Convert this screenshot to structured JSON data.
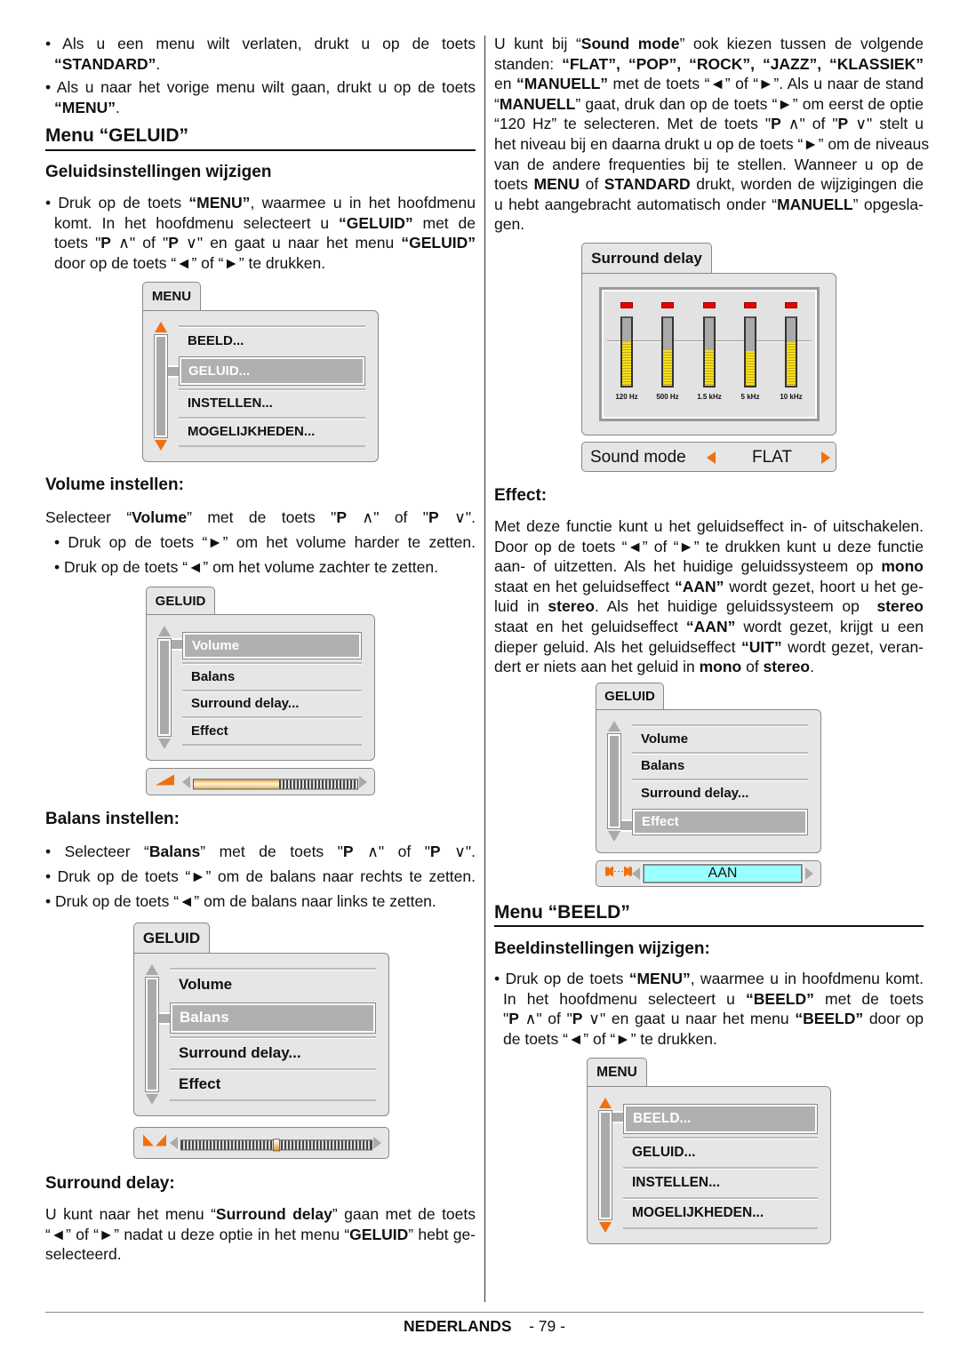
{
  "left": {
    "bullet_exit": [
      [
        "• Als u een menu wilt verlaten, drukt u op de toets"
      ],
      [
        {
          "b": "“STANDARD”"
        },
        "."
      ]
    ],
    "bullet_back": [
      [
        "• Als u naar het vorige menu wilt gaan, drukt u op de toets"
      ],
      [
        {
          "b": "“MENU”"
        },
        "."
      ]
    ],
    "menu_geluid_heading": "Menu “GELUID”",
    "geluid_sub": "Geluidsinstellingen wijzigen",
    "geluid_para": [
      [
        "• Druk op de toets ",
        {
          "b": "“MENU”"
        },
        ", waarmee u in het hoofdmenu"
      ],
      [
        "komt. In het hoofdmenu selecteert u ",
        {
          "b": "“GELUID”"
        },
        " met de"
      ],
      [
        "toets \"",
        {
          "b": "P"
        },
        " ∧\" of \"",
        {
          "b": "P"
        },
        " ∨\" en gaat u naar het menu ",
        {
          "b": "“GELUID”"
        }
      ],
      [
        "door op de toets “◄” of “►” te drukken."
      ]
    ],
    "volume_heading": "Volume instellen:",
    "volume_para": [
      [
        "Selecteer “",
        {
          "b": "Volume"
        },
        "” met de toets \"",
        {
          "b": "P"
        },
        " ∧\" of \"",
        {
          "b": "P"
        },
        " ∨\"."
      ],
      [
        "• Druk op de toets “►” om het volume harder te zetten."
      ],
      [
        "• Druk op de toets “◄” om het volume zachter te zetten."
      ]
    ],
    "balans_heading": "Balans instellen:",
    "balans_para": [
      [
        "• Selecteer “",
        {
          "b": "Balans"
        },
        "” met de toets \"",
        {
          "b": "P"
        },
        " ∧\" of \"",
        {
          "b": "P"
        },
        " ∨\"."
      ],
      [
        "• Druk op de toets “►” om de balans naar rechts te zetten."
      ],
      [
        "• Druk op de toets “◄” om de balans naar links te zetten."
      ]
    ],
    "surround_heading": "Surround delay:",
    "surround_para": [
      [
        "U kunt naar het menu “",
        {
          "b": "Surround delay"
        },
        "” gaan met de toets"
      ],
      [
        "“◄” of “►” nadat u deze optie in het menu “",
        {
          "b": "GELUID"
        },
        "” hebt ge-"
      ],
      [
        "selecteerd."
      ]
    ]
  },
  "right": {
    "soundmode_para": [
      [
        "U kunt bij “",
        {
          "b": "Sound mode"
        },
        "” ook kiezen tussen de volgende"
      ],
      [
        "standen: ",
        {
          "b": "“FLAT”, “POP”, “ROCK”, “JAZZ”, “KLASSIEK”"
        }
      ],
      [
        "en ",
        {
          "b": "“MANUELL”"
        },
        " met de toets “◄” of “►”. Als u naar de stand"
      ],
      [
        "“",
        {
          "b": "MANUELL"
        },
        "” gaat, druk dan op de toets “►” om eerst de optie"
      ],
      [
        "“120 Hz” te selecteren. Met de toets \"",
        {
          "b": "P"
        },
        " ∧\" of \"",
        {
          "b": "P"
        },
        " ∨\" stelt u"
      ],
      [
        "het niveau bij en daarna drukt u op de toets “►” om de niveaus"
      ],
      [
        "van de andere frequenties bij te stellen. Wanneer u op de"
      ],
      [
        "toets ",
        {
          "b": "MENU"
        },
        " of ",
        {
          "b": "STANDARD"
        },
        " drukt, worden de wijzigingen die"
      ],
      [
        "u hebt aangebracht automatisch onder “",
        {
          "b": "MANUELL"
        },
        "” opgesla-"
      ],
      [
        "gen."
      ]
    ],
    "effect_heading": "Effect:",
    "effect_para": [
      [
        "Met deze functie kunt u het geluidseffect in- of uitschakelen."
      ],
      [
        "Door op de toets “◄” of “►” te drukken kunt u deze functie"
      ],
      [
        "aan- of uitzetten. Als het huidige geluidssysteem op ",
        {
          "b": "mono"
        }
      ],
      [
        "staat en het geluidseffect ",
        {
          "b": "“AAN”"
        },
        " wordt gezet, hoort u het ge-"
      ],
      [
        "luid in ",
        {
          "b": "stereo"
        },
        ". Als het huidige geluidssysteem op  ",
        {
          "b": "stereo"
        }
      ],
      [
        "staat en het geluidseffect ",
        {
          "b": "“AAN”"
        },
        " wordt gezet, krijgt u een"
      ],
      [
        "dieper geluid. Als het geluidseffect ",
        {
          "b": "“UIT”"
        },
        " wordt gezet, veran-"
      ],
      [
        "dert er niets aan het geluid in ",
        {
          "b": "mono"
        },
        " of ",
        {
          "b": "stereo"
        },
        "."
      ]
    ],
    "menu_beeld_heading": "Menu “BEELD”",
    "beeld_sub": "Beeldinstellingen wijzigen:",
    "beeld_para": [
      [
        "• Druk op de toets ",
        {
          "b": "“MENU”"
        },
        ", waarmee u in hoofdmenu komt."
      ],
      [
        "In het hoofdmenu selecteert u ",
        {
          "b": "“BEELD”"
        },
        " met de toets"
      ],
      [
        "\"",
        {
          "b": "P"
        },
        " ∧\" of \"",
        {
          "b": "P"
        },
        " ∨\" en gaat u naar het menu ",
        {
          "b": "“BEELD”"
        },
        " door op"
      ],
      [
        "de toets “◄” of “►” te drukken."
      ]
    ]
  },
  "menus": [
    {
      "title": "MENU",
      "items": [
        "BEELD...",
        "GELUID...",
        "INSTELLEN...",
        "MOGELIJKHEDEN..."
      ],
      "selected": 1,
      "arrow_color": "#f07010"
    },
    {
      "title": "GELUID",
      "items": [
        "Volume",
        "Balans",
        "Surround delay...",
        "Effect"
      ],
      "selected": 0,
      "arrow_color": "#aaaaaa",
      "bar": {
        "type": "volume",
        "icon": "volume-icon",
        "level": 0.52
      }
    },
    {
      "title": "GELUID",
      "items": [
        "Volume",
        "Balans",
        "Surround delay...",
        "Effect"
      ],
      "selected": 1,
      "arrow_color": "#aaaaaa",
      "bar": {
        "type": "balance",
        "icon": "balance-icon",
        "level": 0.5
      }
    },
    {
      "title": "GELUID",
      "items": [
        "Volume",
        "Balans",
        "Surround delay...",
        "Effect"
      ],
      "selected": 3,
      "arrow_color": "#aaaaaa",
      "bar": {
        "type": "effect",
        "icon": "speakers-icon",
        "value": "AAN"
      }
    },
    {
      "title": "MENU",
      "items": [
        "BEELD...",
        "GELUID...",
        "INSTELLEN...",
        "MOGELIJKHEDEN..."
      ],
      "selected": 0,
      "arrow_color": "#f07010"
    }
  ],
  "surround": {
    "title": "Surround delay",
    "bands": [
      {
        "label": "120 Hz",
        "level": 0.65
      },
      {
        "label": "500 Hz",
        "level": 0.53
      },
      {
        "label": "1.5 kHz",
        "level": 0.52
      },
      {
        "label": "5 kHz",
        "level": 0.51
      },
      {
        "label": "10 kHz",
        "level": 0.65
      }
    ],
    "sound_mode_label": "Sound mode",
    "sound_mode_value": "FLAT"
  },
  "footer": {
    "language": "NEDERLANDS",
    "page": "- 79 -"
  }
}
